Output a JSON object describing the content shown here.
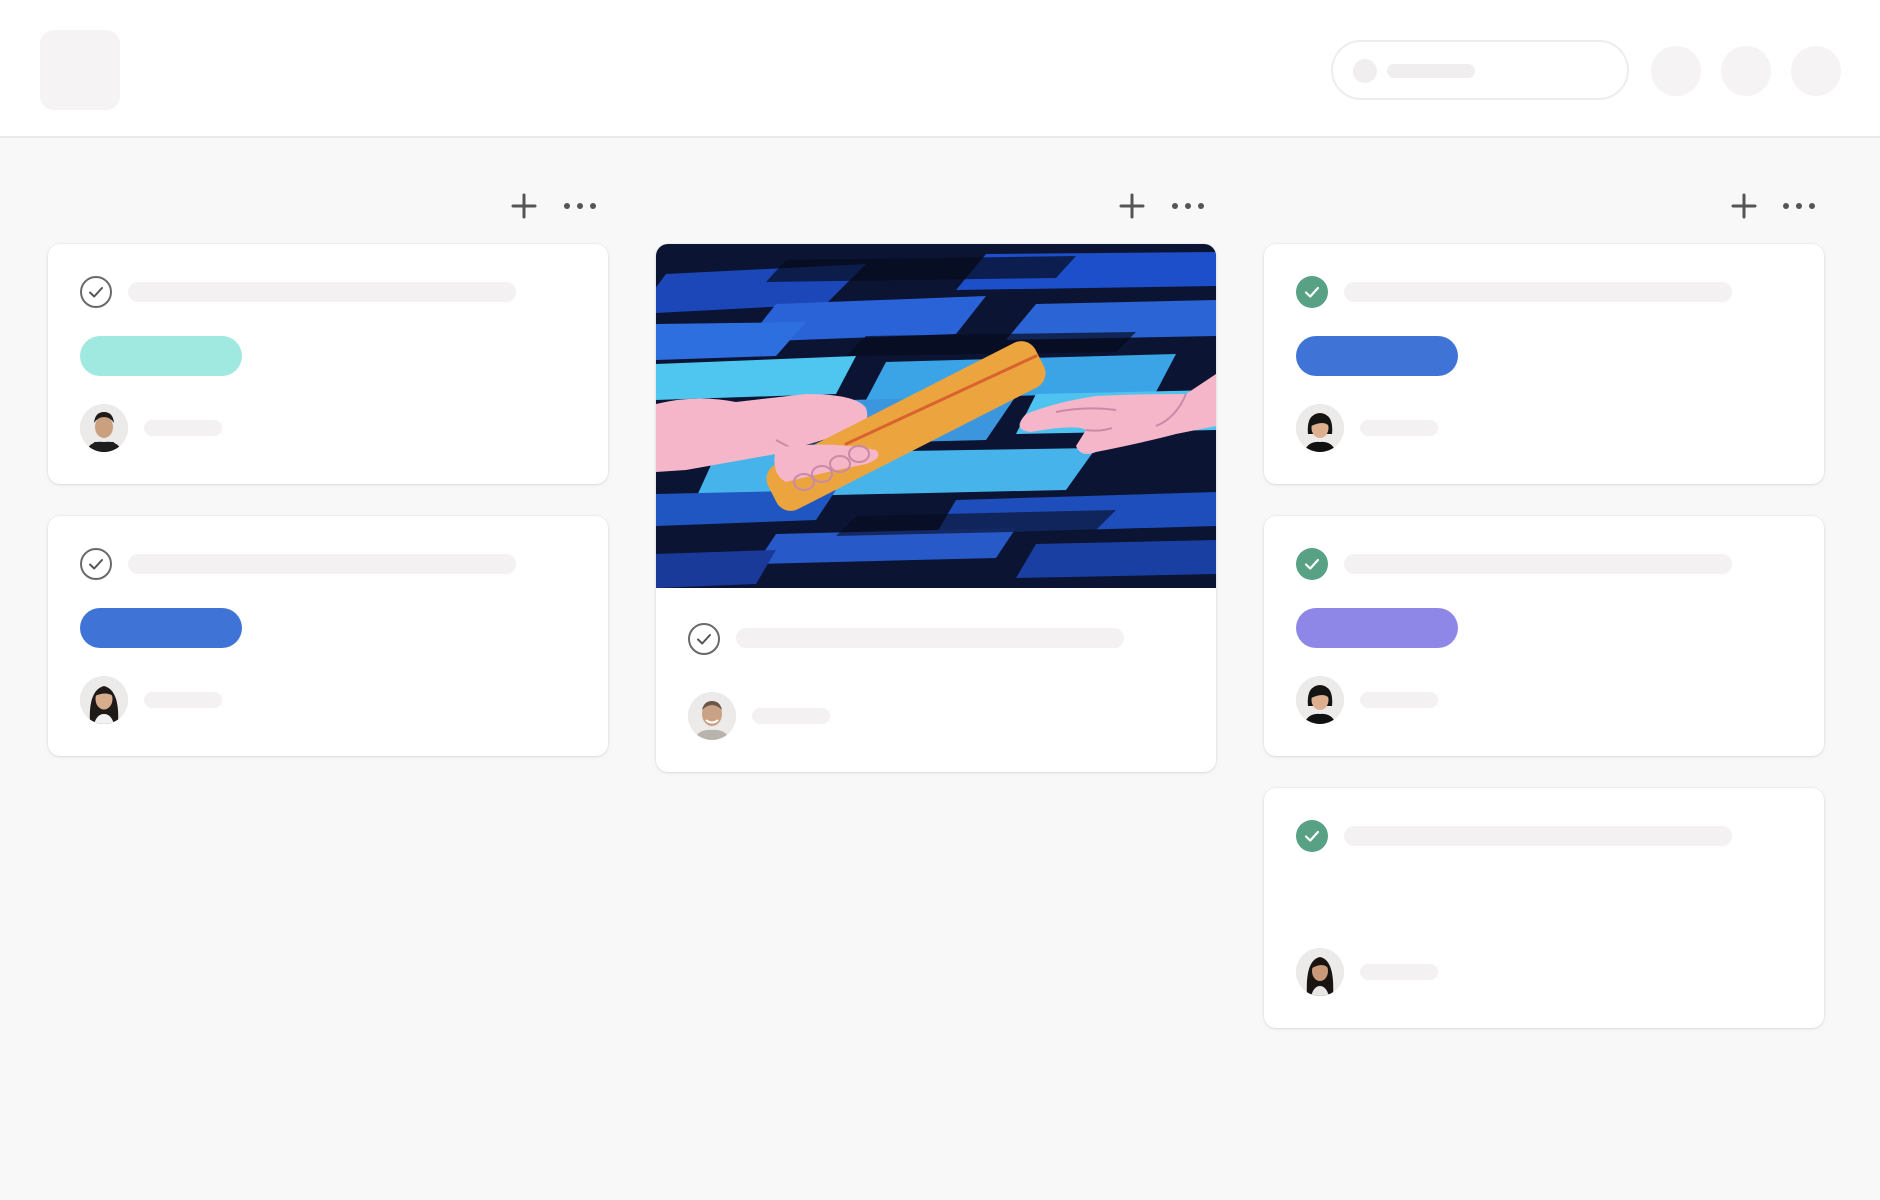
{
  "colors": {
    "page_bg": "#f8f8f8",
    "card_bg": "#ffffff",
    "placeholder": "#f3f1f1",
    "tag_teal": "#a0e9e1",
    "tag_blue": "#4073d6",
    "tag_purple": "#8f87e8",
    "check_done": "#58a184",
    "icon_gray": "#555555"
  },
  "icons": {
    "add": "plus-icon",
    "more": "ellipsis-icon",
    "task_open": "check-circle-outline-icon",
    "task_done": "check-circle-filled-icon"
  },
  "board": {
    "columns": [
      {
        "cards": [
          {
            "status": "open",
            "tag_color": "#a0e9e1",
            "avatar": "man-short-hair"
          },
          {
            "status": "open",
            "tag_color": "#4073d6",
            "avatar": "woman-long-hair"
          }
        ]
      },
      {
        "cards": [
          {
            "status": "open",
            "cover_image": "relay-baton-handoff",
            "avatar": "man-bald"
          }
        ]
      },
      {
        "cards": [
          {
            "status": "done",
            "tag_color": "#4073d6",
            "avatar": "woman-short-hair"
          },
          {
            "status": "done",
            "tag_color": "#8f87e8",
            "avatar": "woman-short-hair"
          },
          {
            "status": "done",
            "avatar": "woman-long-dark-hair"
          }
        ]
      }
    ]
  }
}
